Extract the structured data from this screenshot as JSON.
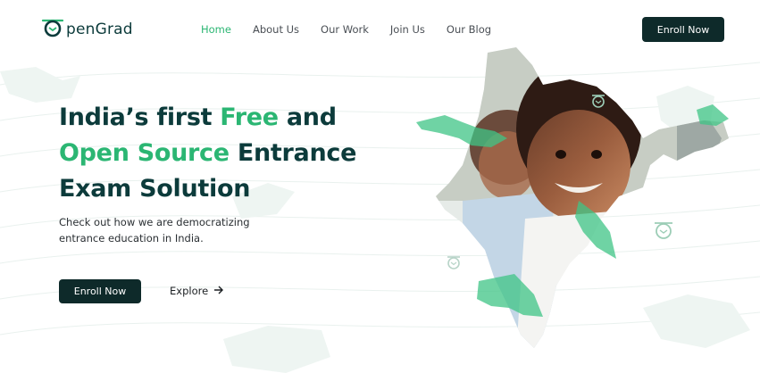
{
  "brand": {
    "name": "penGrad",
    "accent": "#2bb673",
    "dark": "#0e2a2a"
  },
  "nav": {
    "links": [
      {
        "label": "Home",
        "active": true
      },
      {
        "label": "About Us",
        "active": false
      },
      {
        "label": "Our Work",
        "active": false
      },
      {
        "label": "Join Us",
        "active": false
      },
      {
        "label": "Our Blog",
        "active": false
      }
    ],
    "enroll_label": "Enroll Now"
  },
  "hero": {
    "line1_a": "India’s first ",
    "line1_b": "Free",
    "line1_c": " and",
    "line2_a": "Open Source",
    "line2_b": " Entrance",
    "line3": "Exam Solution",
    "subtitle": "Check out how we are democratizing entrance education in India.",
    "enroll_label": "Enroll Now",
    "explore_label": "Explore"
  },
  "icons": {
    "logo": "owl-icon",
    "arrow": "arrow-right-icon",
    "badge": "graduation-cap-icon"
  }
}
